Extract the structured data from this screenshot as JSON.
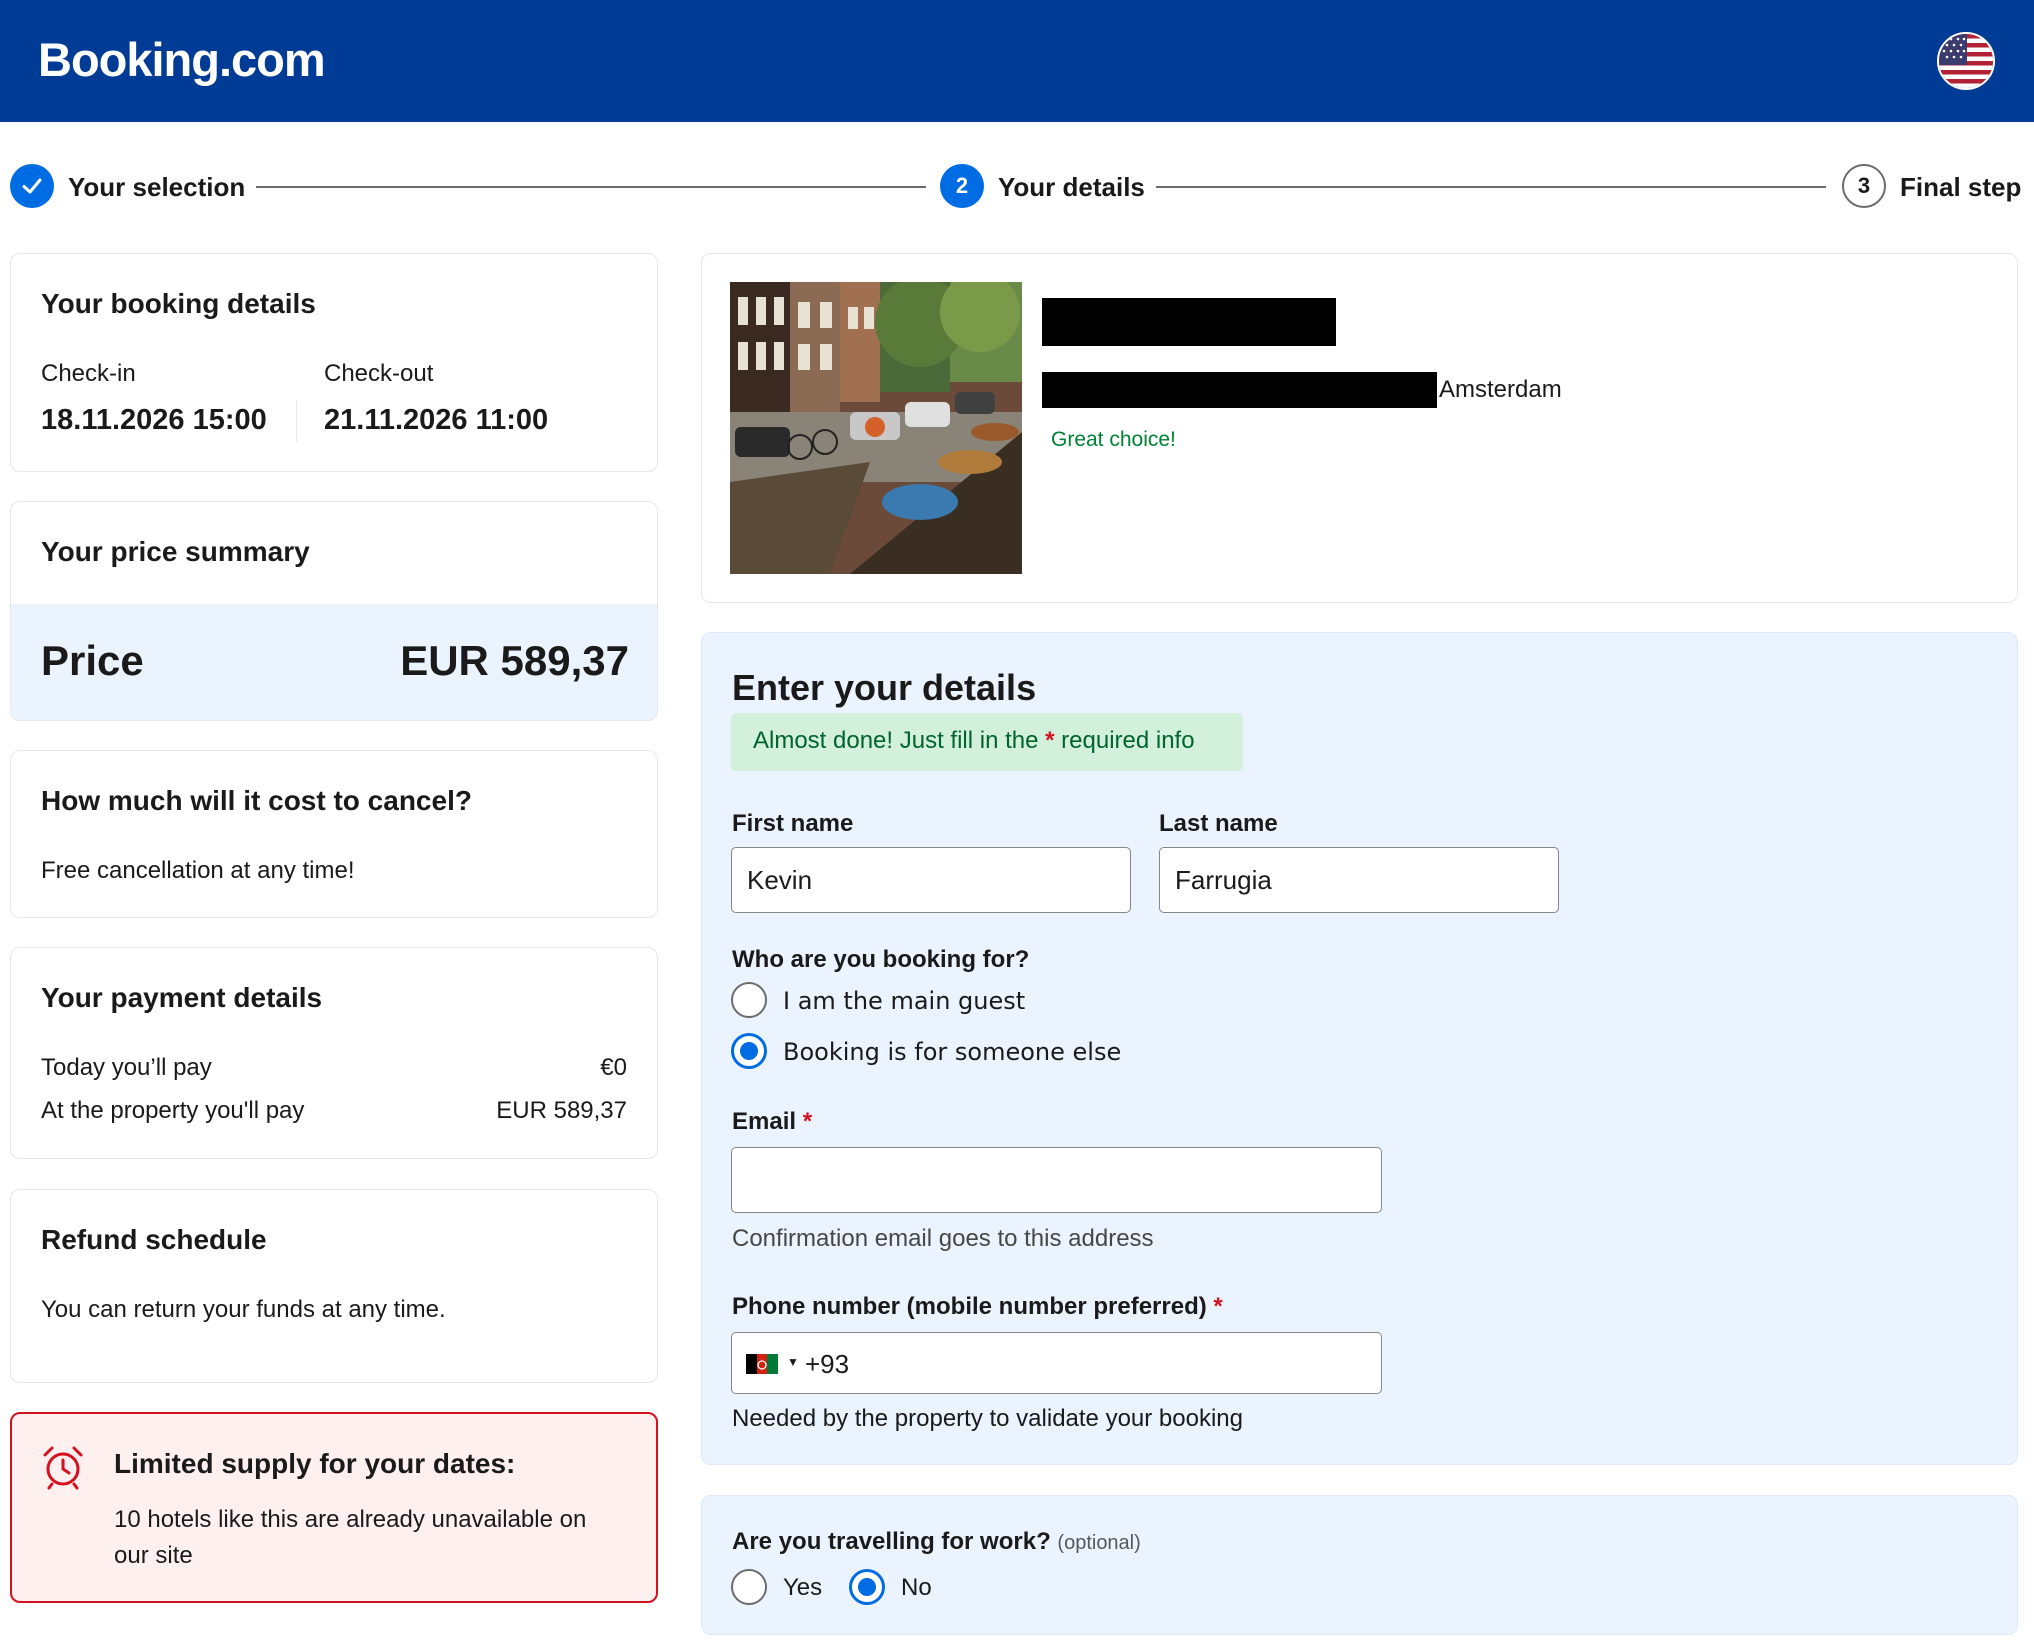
{
  "header": {
    "logo": "Booking.com",
    "language_flag": "us-flag-icon",
    "brand_color": "#003b95"
  },
  "steps": [
    {
      "label": "Your selection",
      "state": "done"
    },
    {
      "label": "Your details",
      "number": "2",
      "state": "current"
    },
    {
      "label": "Final step",
      "number": "3",
      "state": "upcoming"
    }
  ],
  "booking_details": {
    "title": "Your booking details",
    "checkin_label": "Check-in",
    "checkin_value": "18.11.2026 15:00",
    "checkout_label": "Check-out",
    "checkout_value": "21.11.2026 11:00"
  },
  "price_summary": {
    "title": "Your price summary",
    "price_label": "Price",
    "price_value": "EUR 589,37"
  },
  "cancel": {
    "title": "How much will it cost to cancel?",
    "text": "Free cancellation at any time!"
  },
  "payment": {
    "title": "Your payment details",
    "today_label": "Today you’ll pay",
    "today_value": "€0",
    "property_label": "At the property you'll pay",
    "property_value": "EUR 589,37"
  },
  "refund": {
    "title": "Refund schedule",
    "text": "You can return your funds at any time."
  },
  "supply": {
    "title": "Limited supply for your dates:",
    "line1": "10 hotels like this are already unavailable on",
    "line2": "our site",
    "icon": "alarm-clock-icon"
  },
  "property": {
    "city": "Amsterdam",
    "tagline": "Great choice!"
  },
  "details_form": {
    "title": "Enter your details",
    "notice_prefix": "Almost done! Just fill in the ",
    "notice_star": "*",
    "notice_suffix": " required info",
    "first_name_label": "First name",
    "first_name_value": "Kevin",
    "last_name_label": "Last name",
    "last_name_value": "Farrugia",
    "booking_for_label": "Who are you booking for?",
    "booking_for_options": [
      "I am the main guest",
      "Booking is for someone else"
    ],
    "booking_for_selected": "Booking is for someone else",
    "email_label": "Email",
    "required_star": "*",
    "email_value": "",
    "email_hint": "Confirmation email goes to this address",
    "phone_label": "Phone number (mobile number preferred)",
    "phone_code": "+93",
    "phone_country_flag": "afghanistan-flag-icon",
    "phone_hint": "Needed by the property to validate your booking"
  },
  "work": {
    "label": "Are you travelling for work?",
    "optional": "(optional)",
    "yes": "Yes",
    "no": "No",
    "selected": "No"
  },
  "colors": {
    "accent": "#006ce4",
    "success_text": "#008234",
    "form_bg": "#ebf3ff",
    "alert_border": "#d4111e",
    "alert_bg": "#fff0f0"
  }
}
